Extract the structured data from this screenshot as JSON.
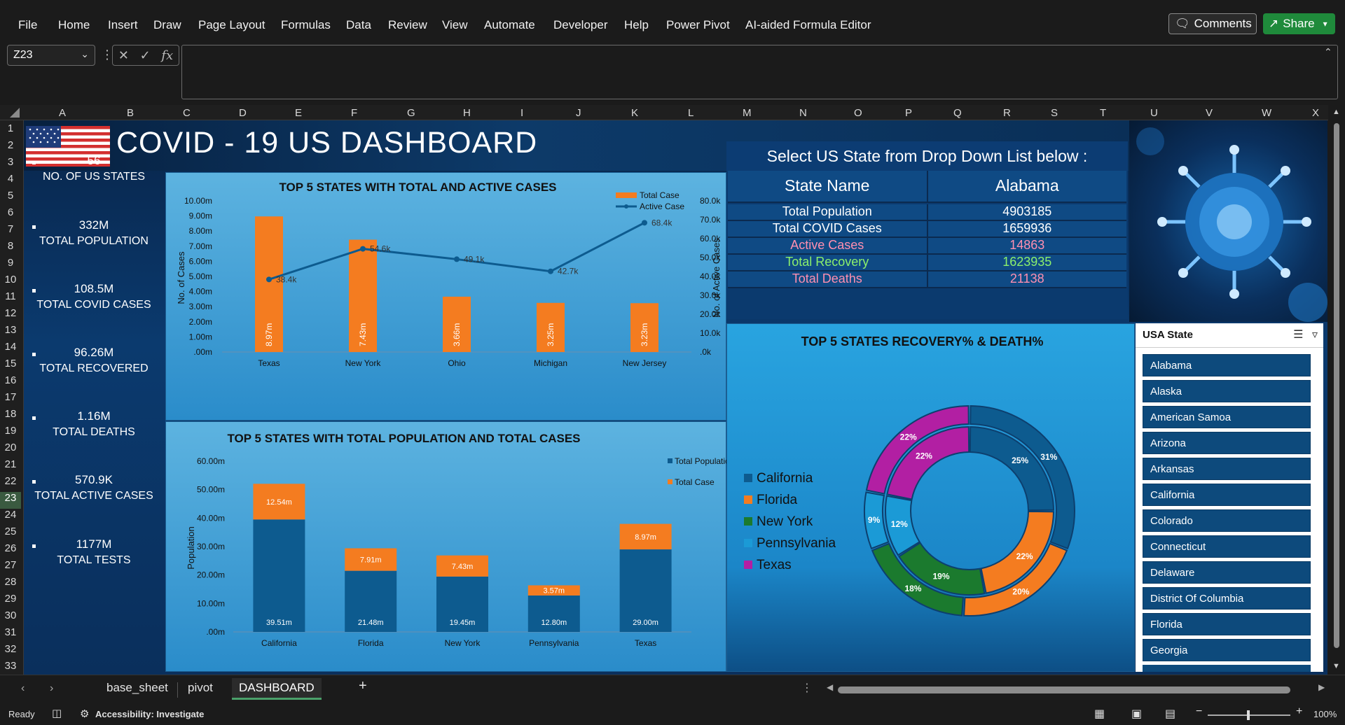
{
  "menu": {
    "items": [
      "File",
      "Home",
      "Insert",
      "Draw",
      "Page Layout",
      "Formulas",
      "Data",
      "Review",
      "View",
      "Automate",
      "Developer",
      "Help",
      "Power Pivot",
      "AI-aided Formula Editor"
    ],
    "comments_label": "Comments",
    "share_label": "Share"
  },
  "formula_bar": {
    "name_box": "Z23",
    "fx_label": "fx",
    "formula": ""
  },
  "grid": {
    "columns": [
      "A",
      "B",
      "C",
      "D",
      "E",
      "F",
      "G",
      "H",
      "I",
      "J",
      "K",
      "L",
      "M",
      "N",
      "O",
      "P",
      "Q",
      "R",
      "S",
      "T",
      "U",
      "V",
      "W",
      "X"
    ],
    "rows": [
      "1",
      "2",
      "3",
      "4",
      "5",
      "6",
      "7",
      "8",
      "9",
      "10",
      "11",
      "12",
      "13",
      "14",
      "15",
      "16",
      "17",
      "18",
      "19",
      "20",
      "21",
      "22",
      "23",
      "24",
      "25",
      "26",
      "27",
      "28",
      "29",
      "30",
      "31",
      "32",
      "33"
    ],
    "selected_row": "23"
  },
  "dashboard": {
    "title": "COVID - 19 US DASHBOARD",
    "kpis": [
      {
        "value": "56",
        "label": "NO. OF US STATES"
      },
      {
        "value": "332M",
        "label": "TOTAL POPULATION"
      },
      {
        "value": "108.5M",
        "label": "TOTAL COVID CASES"
      },
      {
        "value": "96.26M",
        "label": "TOTAL RECOVERED"
      },
      {
        "value": "1.16M",
        "label": "TOTAL DEATHS"
      },
      {
        "value": "570.9K",
        "label": "TOTAL ACTIVE CASES"
      },
      {
        "value": "1177M",
        "label": "TOTAL TESTS"
      }
    ],
    "state_panel": {
      "header": "Select US State from Drop Down List below :",
      "col1": "State Name",
      "col2": "Alabama",
      "rows": [
        {
          "label": "Total Population",
          "value": "4903185",
          "color": "#ffffff"
        },
        {
          "label": "Total COVID Cases",
          "value": "1659936",
          "color": "#ffffff"
        },
        {
          "label": "Active Cases",
          "value": "14863",
          "color": "#ff8fb0"
        },
        {
          "label": "Total Recovery",
          "value": "1623935",
          "color": "#8cf06c"
        },
        {
          "label": "Total Deaths",
          "value": "21138",
          "color": "#ff8fb0"
        }
      ]
    },
    "slicer": {
      "title": "USA State",
      "items": [
        "Alabama",
        "Alaska",
        "American Samoa",
        "Arizona",
        "Arkansas",
        "California",
        "Colorado",
        "Connecticut",
        "Delaware",
        "District Of Columbia",
        "Florida",
        "Georgia"
      ]
    }
  },
  "chart_data": [
    {
      "type": "bar",
      "title": "TOP 5 STATES WITH TOTAL AND ACTIVE CASES",
      "categories": [
        "Texas",
        "New York",
        "Ohio",
        "Michigan",
        "New Jersey"
      ],
      "ylabel": "No. of Cases",
      "y2label": "No. of Active Cases",
      "ylim": [
        0,
        10
      ],
      "y_ticks": [
        "10.00m",
        "9.00m",
        "8.00m",
        "7.00m",
        "6.00m",
        "5.00m",
        "4.00m",
        "3.00m",
        "2.00m",
        "1.00m",
        ".00m"
      ],
      "y2lim": [
        0,
        80
      ],
      "y2_ticks": [
        "80.0k",
        "70.0k",
        "60.0k",
        "50.0k",
        "40.0k",
        "30.0k",
        "20.0k",
        "10.0k",
        ".0k"
      ],
      "legend": "top-right",
      "series": [
        {
          "name": "Total Case",
          "kind": "bar",
          "color": "#f47c20",
          "values": [
            8.97,
            7.43,
            3.66,
            3.25,
            3.23
          ],
          "labels": [
            "8.97m",
            "7.43m",
            "3.66m",
            "3.25m",
            "3.23m"
          ]
        },
        {
          "name": "Active Case",
          "kind": "line",
          "color": "#0d5b8f",
          "values": [
            38.4,
            54.6,
            49.1,
            42.7,
            68.4
          ],
          "labels": [
            "38.4k",
            "54.6k",
            "49.1k",
            "42.7k",
            "68.4k"
          ]
        }
      ]
    },
    {
      "type": "bar",
      "title": "TOP 5 STATES WITH TOTAL POPULATION AND TOTAL CASES",
      "categories": [
        "California",
        "Florida",
        "New York",
        "Pennsylvania",
        "Texas"
      ],
      "ylabel": "Population",
      "ylim": [
        0,
        60
      ],
      "y_ticks": [
        "60.00m",
        "50.00m",
        "40.00m",
        "30.00m",
        "20.00m",
        "10.00m",
        ".00m"
      ],
      "stacked": true,
      "legend": "top-right",
      "series": [
        {
          "name": "Total Population",
          "color": "#0d5b8f",
          "values": [
            39.51,
            21.48,
            19.45,
            12.8,
            29.0
          ],
          "labels": [
            "39.51m",
            "21.48m",
            "19.45m",
            "12.80m",
            "29.00m"
          ]
        },
        {
          "name": "Total Case",
          "color": "#f47c20",
          "values": [
            12.54,
            7.91,
            7.43,
            3.57,
            8.97
          ],
          "labels": [
            "12.54m",
            "7.91m",
            "7.43m",
            "3.57m",
            "8.97m"
          ]
        }
      ]
    },
    {
      "type": "pie",
      "title": "TOP 5 STATES RECOVERY% & DEATH%",
      "categories": [
        "California",
        "Florida",
        "New York",
        "Pennsylvania",
        "Texas"
      ],
      "colors": [
        "#0d5b8f",
        "#f47c20",
        "#1b7a2e",
        "#1b9ad6",
        "#b21fa3"
      ],
      "legend": "left",
      "series": [
        {
          "name": "outer",
          "values": [
            31,
            20,
            18,
            9,
            22
          ],
          "labels": [
            "31%",
            "20%",
            "18%",
            "9%",
            "22%"
          ]
        },
        {
          "name": "inner",
          "values": [
            25,
            22,
            19,
            12,
            22
          ],
          "labels": [
            "25%",
            "22%",
            "19%",
            "12%",
            "22%"
          ]
        }
      ]
    }
  ],
  "sheets": {
    "tabs": [
      "base_sheet",
      "pivot",
      "DASHBOARD"
    ],
    "active": "DASHBOARD",
    "add_label": "+"
  },
  "status": {
    "ready": "Ready",
    "accessibility": "Accessibility: Investigate",
    "zoom": "100%"
  }
}
